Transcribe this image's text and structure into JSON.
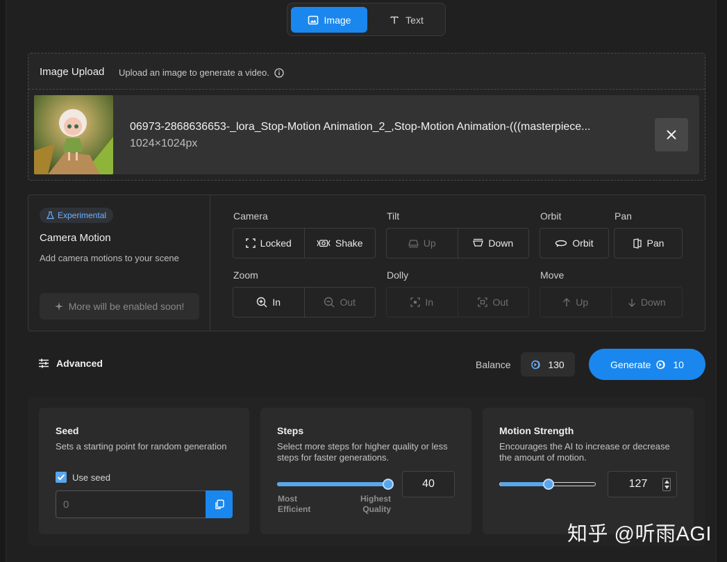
{
  "mode_toggle": {
    "image_label": "Image",
    "text_label": "Text"
  },
  "upload": {
    "title": "Image Upload",
    "subtitle": "Upload an image to generate a video.",
    "file_name": "06973-2868636653-_lora_Stop-Motion Animation_2_,Stop-Motion Animation-(((masterpiece...",
    "file_size": "1024×1024px"
  },
  "camera_motion": {
    "badge": "Experimental",
    "title": "Camera Motion",
    "description": "Add camera motions to your scene",
    "soon_label": "More will be enabled soon!",
    "groups": {
      "camera": {
        "label": "Camera",
        "options": [
          "Locked",
          "Shake"
        ]
      },
      "tilt": {
        "label": "Tilt",
        "options": [
          "Up",
          "Down"
        ]
      },
      "orbit": {
        "label": "Orbit",
        "options": [
          "Orbit"
        ]
      },
      "pan": {
        "label": "Pan",
        "options": [
          "Pan"
        ]
      },
      "zoom": {
        "label": "Zoom",
        "options": [
          "In",
          "Out"
        ]
      },
      "dolly": {
        "label": "Dolly",
        "options": [
          "In",
          "Out"
        ]
      },
      "move": {
        "label": "Move",
        "options": [
          "Up",
          "Down"
        ]
      }
    }
  },
  "actions": {
    "advanced_label": "Advanced",
    "balance_label": "Balance",
    "balance_value": "130",
    "generate_label": "Generate",
    "generate_cost": "10"
  },
  "advanced": {
    "seed": {
      "title": "Seed",
      "description": "Sets a starting point for random generation",
      "use_seed_label": "Use seed",
      "use_seed_checked": true,
      "placeholder": "0"
    },
    "steps": {
      "title": "Steps",
      "description": "Select more steps for higher quality or less steps for faster generations.",
      "value": "40",
      "slider_fraction": 1.0,
      "min_caption": "Most Efficient",
      "max_caption": "Highest Quality"
    },
    "motion_strength": {
      "title": "Motion Strength",
      "description": "Encourages the AI to increase or decrease the amount of motion.",
      "value": "127",
      "slider_fraction": 0.5
    }
  },
  "watermark": "知乎 @听雨AGI",
  "colors": {
    "accent": "#1a87ee",
    "slider": "#5aa6ea",
    "experimental": "#6fb3ff"
  }
}
